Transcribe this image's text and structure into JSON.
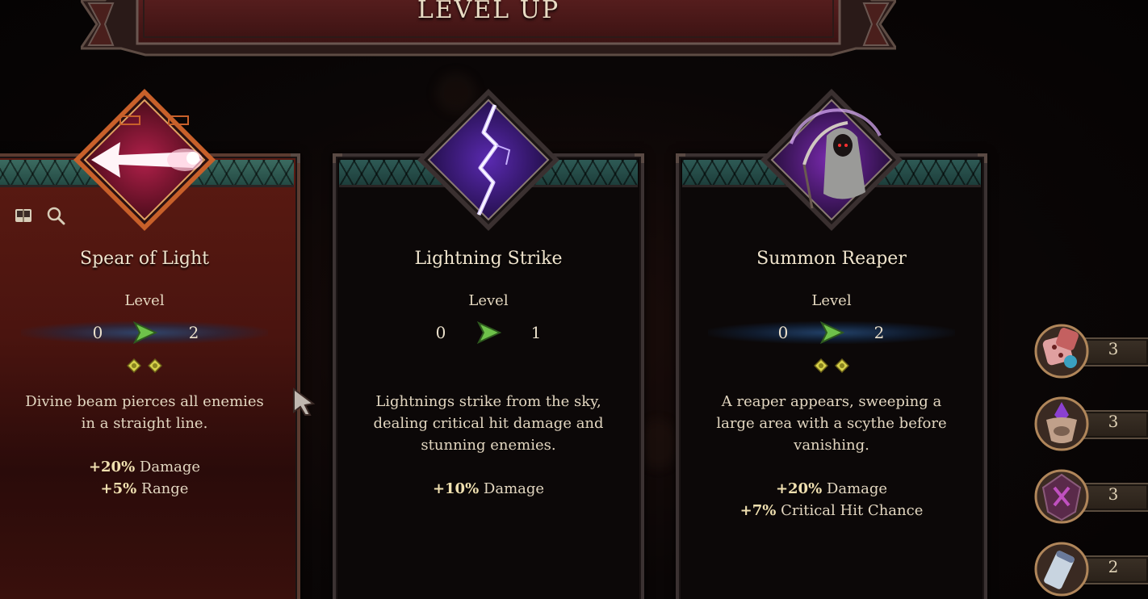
{
  "title": "LEVEL UP",
  "cards": [
    {
      "name": "Spear of Light",
      "level_label": "Level",
      "level_from": "0",
      "level_to": "2",
      "gems": 2,
      "description": [
        "Divine beam pierces all enemies",
        "in a straight line."
      ],
      "stats": [
        {
          "value": "+20%",
          "label": "Damage"
        },
        {
          "value": "+5%",
          "label": "Range"
        }
      ],
      "selected": true,
      "icon": "spear-of-light-icon"
    },
    {
      "name": "Lightning Strike",
      "level_label": "Level",
      "level_from": "0",
      "level_to": "1",
      "gems": 0,
      "description": [
        "Lightnings strike from the sky,",
        "dealing critical hit damage and",
        "stunning enemies."
      ],
      "stats": [
        {
          "value": "+10%",
          "label": "Damage"
        }
      ],
      "selected": false,
      "icon": "lightning-strike-icon"
    },
    {
      "name": "Summon Reaper",
      "level_label": "Level",
      "level_from": "0",
      "level_to": "2",
      "gems": 2,
      "description": [
        "A reaper appears, sweeping a",
        "large area with a scythe before",
        "vanishing."
      ],
      "stats": [
        {
          "value": "+20%",
          "label": "Damage"
        },
        {
          "value": "+7%",
          "label": "Critical Hit Chance"
        }
      ],
      "selected": false,
      "icon": "summon-reaper-icon"
    }
  ],
  "inventory": [
    {
      "icon": "dice-icon",
      "count": "3"
    },
    {
      "icon": "crystal-totem-icon",
      "count": "3"
    },
    {
      "icon": "rune-shield-icon",
      "count": "3"
    },
    {
      "icon": "scroll-icon",
      "count": "2"
    }
  ],
  "colors": {
    "selected_card": "#4a140f",
    "band_teal": "#2e5a55",
    "gem_yellow": "#d6d04a",
    "arrow_green": "#6ec24a"
  }
}
